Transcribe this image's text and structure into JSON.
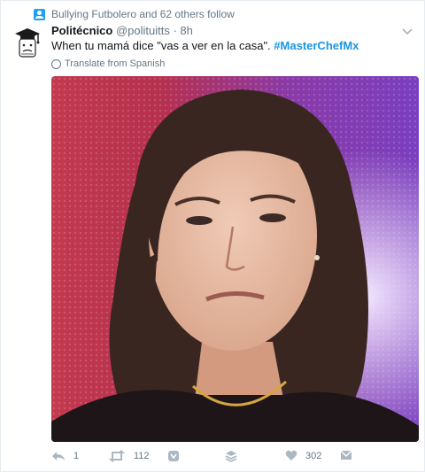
{
  "context": {
    "text": "Bullying Futbolero and 62 others follow"
  },
  "tweet": {
    "name": "Politécnico",
    "handle_time": "@polituitts · 8h",
    "text_plain": "When tu mamá dice \"vas a ver en la casa\". ",
    "hashtag": "#MasterChefMx",
    "translate": "Translate from Spanish"
  },
  "actions": {
    "reply_count": "1",
    "retweet_count": "112",
    "like_count": "302"
  },
  "icons": {
    "context": "person-icon",
    "chevron": "chevron-down-icon",
    "translate": "globe-icon",
    "reply": "reply-icon",
    "retweet": "retweet-icon",
    "moments": "moment-icon",
    "stack": "layers-icon",
    "like": "heart-icon",
    "dm": "message-icon"
  },
  "colors": {
    "accent": "#1b95e0",
    "meta": "#657786",
    "icons": "#aab8c2"
  }
}
